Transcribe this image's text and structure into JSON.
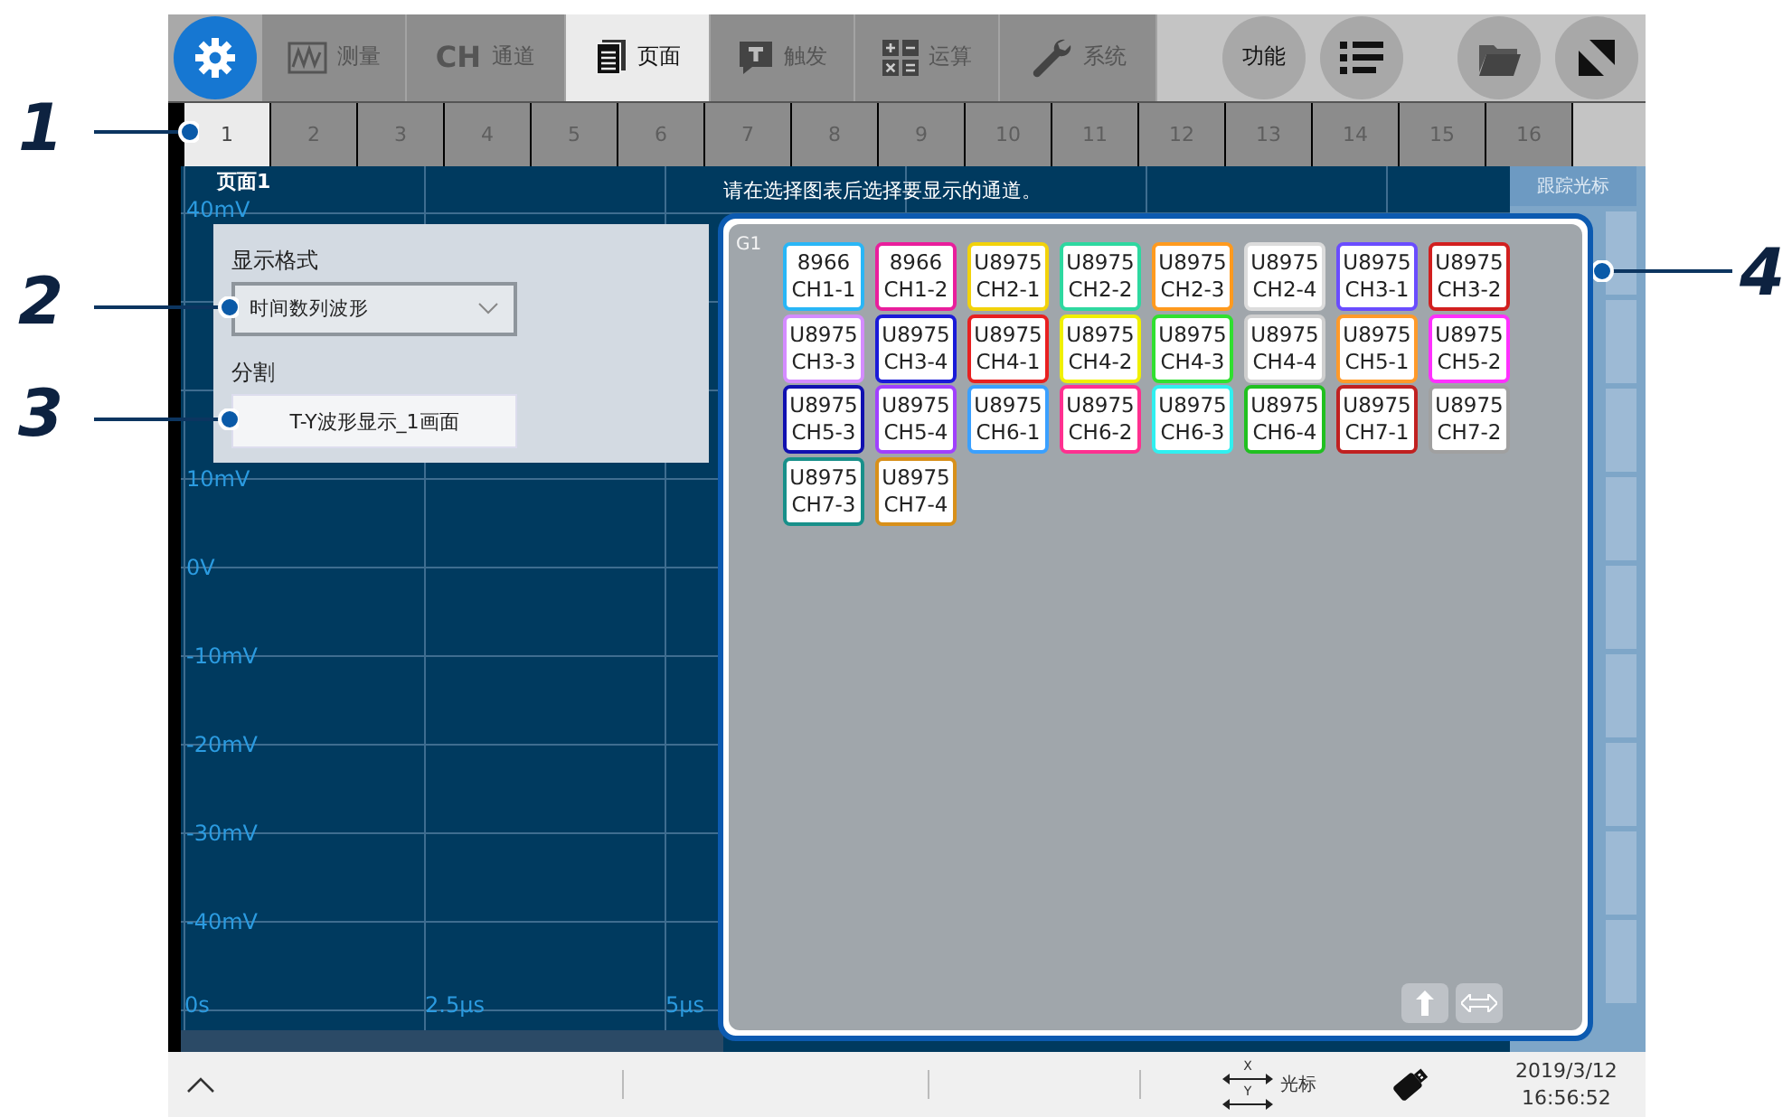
{
  "top_tabs": [
    {
      "kind": "wave",
      "label": "测量",
      "selected": false
    },
    {
      "kind": "ch",
      "badge": "CH",
      "label": "通道",
      "selected": false
    },
    {
      "kind": "page",
      "label": "页面",
      "selected": true
    },
    {
      "kind": "trigger",
      "label": "触发",
      "selected": false
    },
    {
      "kind": "calc",
      "label": "运算",
      "selected": false
    },
    {
      "kind": "wrench",
      "label": "系统",
      "selected": false
    }
  ],
  "round_buttons": [
    {
      "kind": "text",
      "label": "功能"
    },
    {
      "kind": "list"
    },
    {
      "kind": "folder"
    },
    {
      "kind": "resize"
    }
  ],
  "page_tabs": [
    {
      "label": "1",
      "selected": true
    },
    {
      "label": "2",
      "selected": false
    },
    {
      "label": "3",
      "selected": false
    },
    {
      "label": "4",
      "selected": false
    },
    {
      "label": "5",
      "selected": false
    },
    {
      "label": "6",
      "selected": false
    },
    {
      "label": "7",
      "selected": false
    },
    {
      "label": "8",
      "selected": false
    },
    {
      "label": "9",
      "selected": false
    },
    {
      "label": "10",
      "selected": false
    },
    {
      "label": "11",
      "selected": false
    },
    {
      "label": "12",
      "selected": false
    },
    {
      "label": "13",
      "selected": false
    },
    {
      "label": "14",
      "selected": false
    },
    {
      "label": "15",
      "selected": false
    },
    {
      "label": "16",
      "selected": false
    }
  ],
  "graph": {
    "title": "页面1",
    "y_top_label": "40mV",
    "y_labels": [
      "10mV",
      "0V",
      "-10mV",
      "-20mV",
      "-30mV",
      "-40mV"
    ],
    "x_labels": [
      "0s",
      "2.5μs",
      "5μs"
    ]
  },
  "display_panel": {
    "format_label": "显示格式",
    "format_value": "时间数列波形",
    "split_label": "分割",
    "split_value": "T-Y波形显示_1画面"
  },
  "side_buttons": [
    {
      "label": "跟踪光标"
    }
  ],
  "channel_panel": {
    "instruction": "请在选择图表后选择要显示的通道。",
    "group": "G1",
    "channels": [
      {
        "model": "8966",
        "channel": "CH1-1",
        "color": "#29b6f6"
      },
      {
        "model": "8966",
        "channel": "CH1-2",
        "color": "#e91e9c"
      },
      {
        "model": "U8975",
        "channel": "CH2-1",
        "color": "#f2d20a"
      },
      {
        "model": "U8975",
        "channel": "CH2-2",
        "color": "#2ed8a0"
      },
      {
        "model": "U8975",
        "channel": "CH2-3",
        "color": "#ff9a1e"
      },
      {
        "model": "U8975",
        "channel": "CH2-4",
        "color": "#dcdcdc"
      },
      {
        "model": "U8975",
        "channel": "CH3-1",
        "color": "#6a4cff"
      },
      {
        "model": "U8975",
        "channel": "CH3-2",
        "color": "#d21f1f"
      },
      {
        "model": "U8975",
        "channel": "CH3-3",
        "color": "#d48cff"
      },
      {
        "model": "U8975",
        "channel": "CH3-4",
        "color": "#1a1ad8"
      },
      {
        "model": "U8975",
        "channel": "CH4-1",
        "color": "#e82020"
      },
      {
        "model": "U8975",
        "channel": "CH4-2",
        "color": "#f0f000"
      },
      {
        "model": "U8975",
        "channel": "CH4-3",
        "color": "#30e030"
      },
      {
        "model": "U8975",
        "channel": "CH4-4",
        "color": "#cfcfcf"
      },
      {
        "model": "U8975",
        "channel": "CH5-1",
        "color": "#ff9a2a"
      },
      {
        "model": "U8975",
        "channel": "CH5-2",
        "color": "#ff30ff"
      },
      {
        "model": "U8975",
        "channel": "CH5-3",
        "color": "#1010b0"
      },
      {
        "model": "U8975",
        "channel": "CH5-4",
        "color": "#a040ff"
      },
      {
        "model": "U8975",
        "channel": "CH6-1",
        "color": "#3aa0ff"
      },
      {
        "model": "U8975",
        "channel": "CH6-2",
        "color": "#ff3090"
      },
      {
        "model": "U8975",
        "channel": "CH6-3",
        "color": "#30f0f0"
      },
      {
        "model": "U8975",
        "channel": "CH6-4",
        "color": "#20c020"
      },
      {
        "model": "U8975",
        "channel": "CH7-1",
        "color": "#c02020"
      },
      {
        "model": "U8975",
        "channel": "CH7-2",
        "color": "#a0a0a0"
      },
      {
        "model": "U8975",
        "channel": "CH7-3",
        "color": "#18908a"
      },
      {
        "model": "U8975",
        "channel": "CH7-4",
        "color": "#d8901a"
      }
    ]
  },
  "status_bar": {
    "cursor_axes": [
      "X",
      "Y"
    ],
    "cursor_label": "光标",
    "date": "2019/3/12",
    "time": "16:56:52"
  },
  "callouts": [
    {
      "number": "1"
    },
    {
      "number": "2"
    },
    {
      "number": "3"
    },
    {
      "number": "4"
    }
  ]
}
